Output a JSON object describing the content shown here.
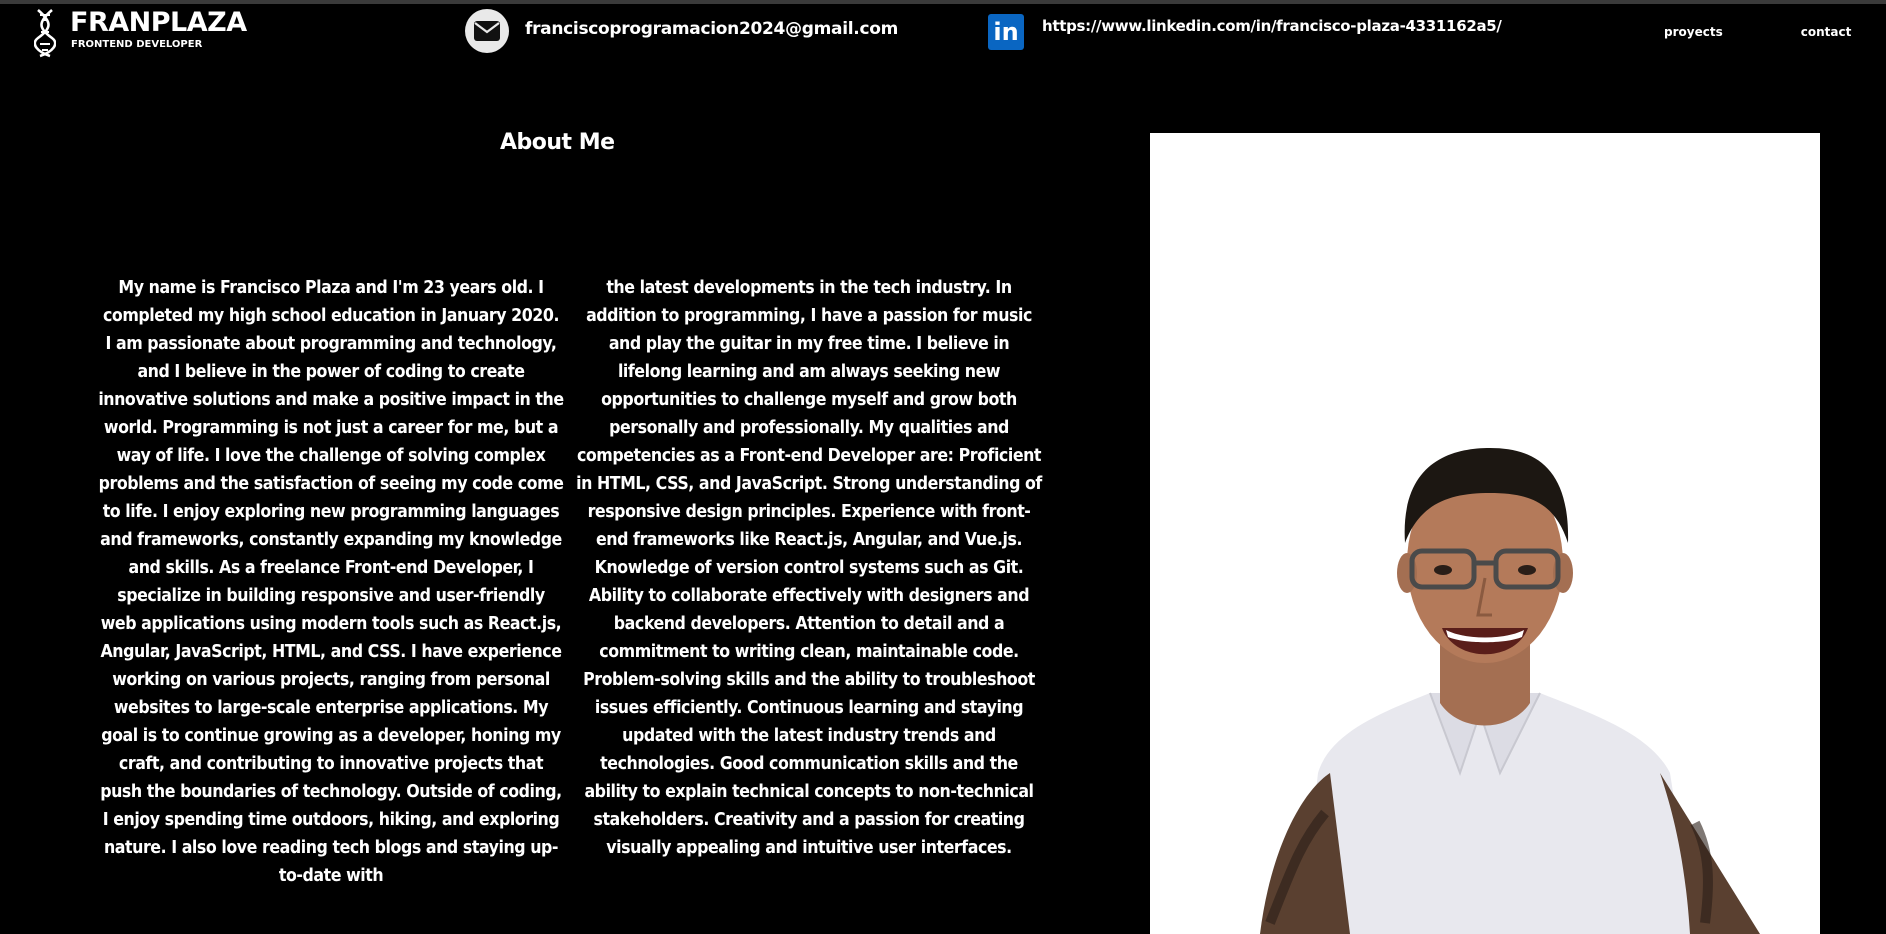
{
  "header": {
    "brand_name": "FRANPLAZA",
    "brand_role": "FRONTEND DEVELOPER",
    "email": "franciscoprogramacion2024@gmail.com",
    "linkedin": "https://www.linkedin.com/in/francisco-plaza-4331162a5/",
    "linkedin_icon_text": "in",
    "nav": {
      "projects": "proyects",
      "contact": "contact"
    }
  },
  "about": {
    "title": "About Me",
    "column1": "My name is Francisco Plaza and I'm 23 years old. I completed my high school education in January 2020. I am passionate about programming and technology, and I believe in the power of coding to create innovative solutions and make a positive impact in the world. Programming is not just a career for me, but a way of life. I love the challenge of solving complex problems and the satisfaction of seeing my code come to life. I enjoy exploring new programming languages and frameworks, constantly expanding my knowledge and skills. As a freelance Front-end Developer, I specialize in building responsive and user-friendly web applications using modern tools such as React.js, Angular, JavaScript, HTML, and CSS. I have experience working on various projects, ranging from personal websites to large-scale enterprise applications. My goal is to continue growing as a developer, honing my craft, and contributing to innovative projects that push the boundaries of technology. Outside of coding, I enjoy spending time outdoors, hiking, and exploring nature. I also love reading tech blogs and staying up-to-date with",
    "column2": "the latest developments in the tech industry. In addition to programming, I have a passion for music and play the guitar in my free time. I believe in lifelong learning and am always seeking new opportunities to challenge myself and grow both personally and professionally. My qualities and competencies as a Front-end Developer are: Proficient in HTML, CSS, and JavaScript. Strong understanding of responsive design principles. Experience with front-end frameworks like React.js, Angular, and Vue.js. Knowledge of version control systems such as Git. Ability to collaborate effectively with designers and backend developers. Attention to detail and a commitment to writing clean, maintainable code. Problem-solving skills and the ability to troubleshoot issues efficiently. Continuous learning and staying updated with the latest industry trends and technologies. Good communication skills and the ability to explain technical concepts to non-technical stakeholders. Creativity and a passion for creating visually appealing and intuitive user interfaces."
  },
  "icons": {
    "logo": "dna-icon",
    "email": "envelope-icon",
    "linkedin": "linkedin-icon"
  },
  "colors": {
    "background": "#000000",
    "text": "#ffffff",
    "linkedin_blue": "#0a66c2",
    "photo_background": "#ffffff"
  }
}
